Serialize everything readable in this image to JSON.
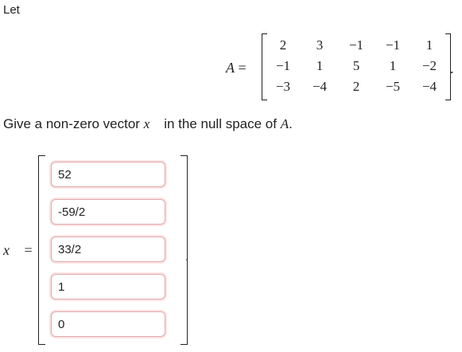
{
  "intro": "Let",
  "matrix": {
    "lhs_label": "A",
    "lhs_eq": "=",
    "rows": [
      [
        "2",
        "3",
        "−1",
        "−1",
        "1"
      ],
      [
        "−1",
        "1",
        "5",
        "1",
        "−2"
      ],
      [
        "−3",
        "−4",
        "2",
        "−5",
        "−4"
      ]
    ],
    "trailing": "."
  },
  "question": {
    "text_before": "Give a non-zero vector ",
    "vector_symbol": "x⃗",
    "text_middle": " in the null space of ",
    "matrix_symbol": "A",
    "text_after": "."
  },
  "vector": {
    "lhs_label": "x⃗",
    "lhs_eq": "=",
    "entries": [
      "52",
      "-59/2",
      "33/2",
      "1",
      "0"
    ],
    "trailing": "."
  }
}
